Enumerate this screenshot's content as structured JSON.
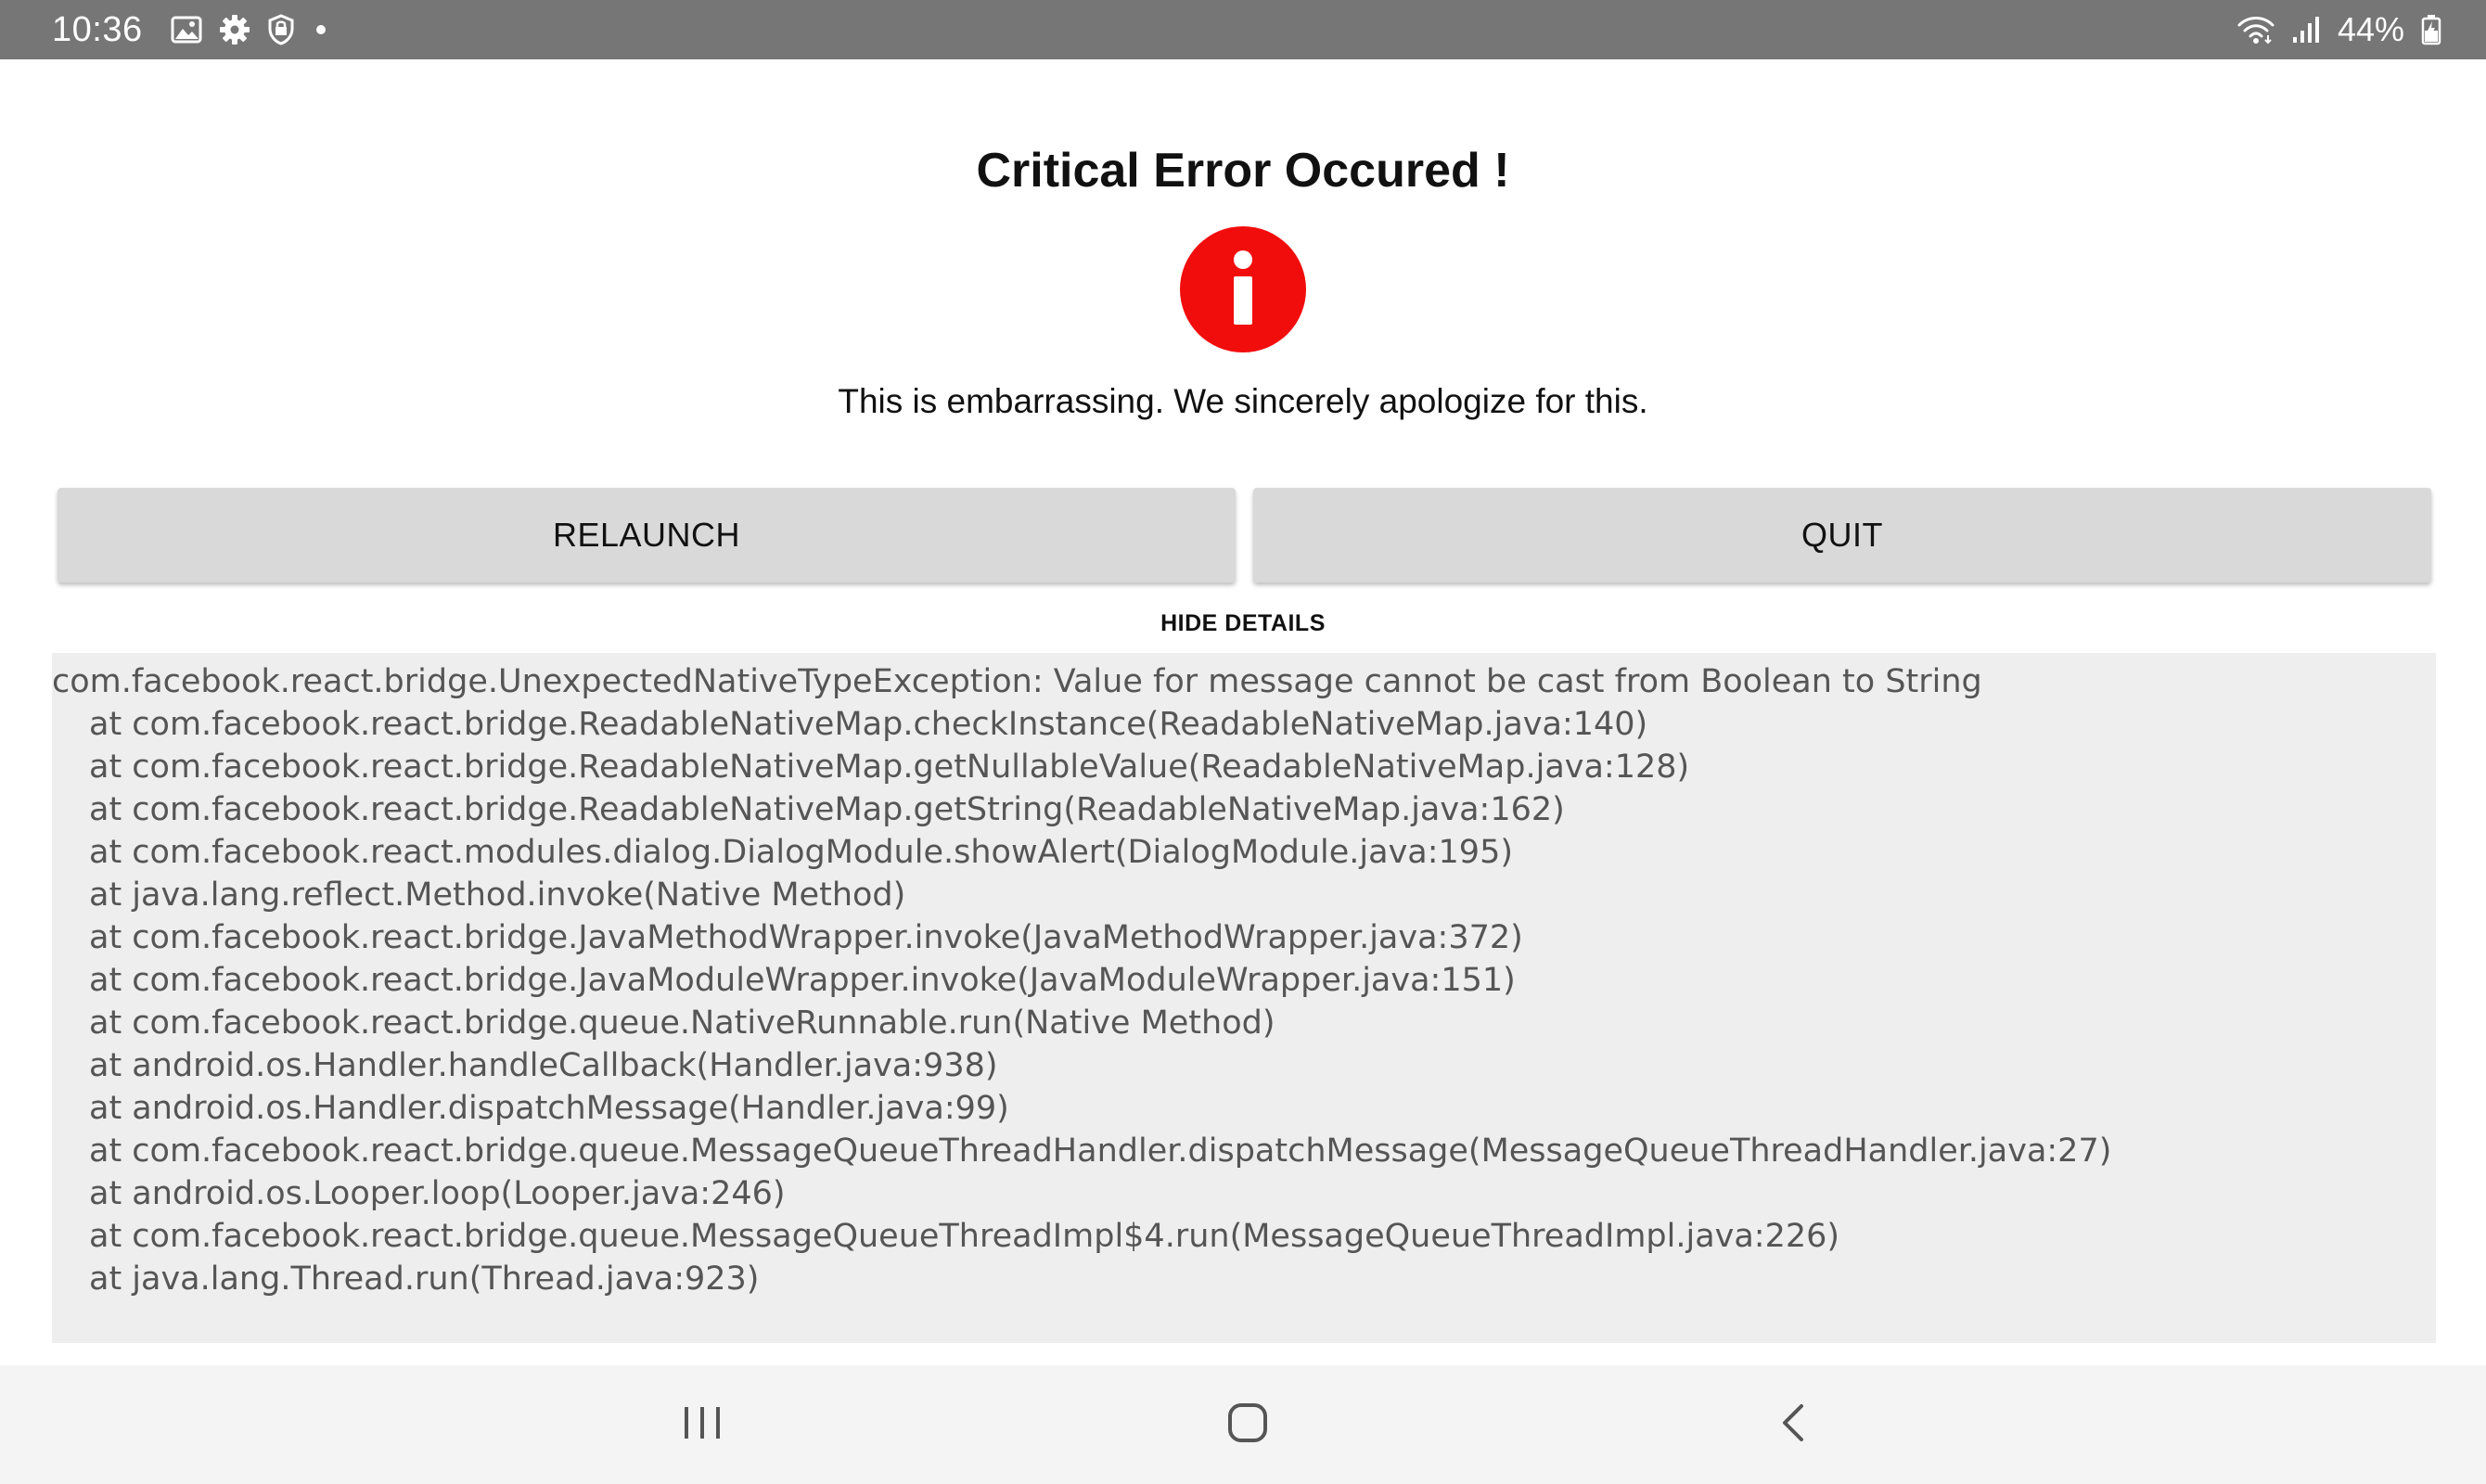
{
  "status_bar": {
    "time": "10:36",
    "battery_percent": "44%",
    "icons": [
      "image-icon",
      "gear-icon",
      "shield-icon",
      "dot-icon",
      "wifi-icon",
      "signal-icon",
      "battery-icon"
    ]
  },
  "dialog": {
    "title": "Critical Error Occured !",
    "icon": "info-icon",
    "icon_color": "#f20d0d",
    "message": "This is embarrassing. We sincerely apologize for this.",
    "relaunch_label": "RELAUNCH",
    "quit_label": "QUIT",
    "details_toggle_label": "HIDE DETAILS"
  },
  "stack_trace": {
    "exception": "com.facebook.react.bridge.UnexpectedNativeTypeException: Value for message cannot be cast from Boolean to String",
    "frames": [
      "at com.facebook.react.bridge.ReadableNativeMap.checkInstance(ReadableNativeMap.java:140)",
      "at com.facebook.react.bridge.ReadableNativeMap.getNullableValue(ReadableNativeMap.java:128)",
      "at com.facebook.react.bridge.ReadableNativeMap.getString(ReadableNativeMap.java:162)",
      "at com.facebook.react.modules.dialog.DialogModule.showAlert(DialogModule.java:195)",
      "at java.lang.reflect.Method.invoke(Native Method)",
      "at com.facebook.react.bridge.JavaMethodWrapper.invoke(JavaMethodWrapper.java:372)",
      "at com.facebook.react.bridge.JavaModuleWrapper.invoke(JavaModuleWrapper.java:151)",
      "at com.facebook.react.bridge.queue.NativeRunnable.run(Native Method)",
      "at android.os.Handler.handleCallback(Handler.java:938)",
      "at android.os.Handler.dispatchMessage(Handler.java:99)",
      "at com.facebook.react.bridge.queue.MessageQueueThreadHandler.dispatchMessage(MessageQueueThreadHandler.java:27)",
      "at android.os.Looper.loop(Looper.java:246)",
      "at com.facebook.react.bridge.queue.MessageQueueThreadImpl$4.run(MessageQueueThreadImpl.java:226)",
      "at java.lang.Thread.run(Thread.java:923)"
    ]
  },
  "nav_bar": {
    "icons": [
      "recents-icon",
      "home-icon",
      "back-icon"
    ]
  }
}
